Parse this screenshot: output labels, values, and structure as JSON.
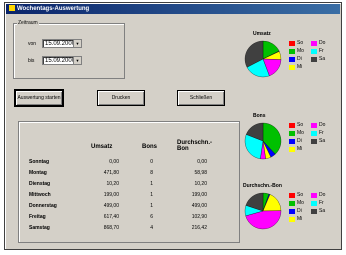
{
  "window": {
    "title": "Wochentags-Auswertung"
  },
  "zeitraum": {
    "group_label": "Zeitraum",
    "von_label": "von",
    "von_value": "15.09.2000",
    "bis_label": "bis",
    "bis_value": "15.09.2000"
  },
  "buttons": {
    "start": "Auswertung starten",
    "print": "Drucken",
    "close": "Schließen"
  },
  "table": {
    "headers": [
      "Umsatz",
      "Bons",
      "Durchschn.- Bon"
    ],
    "rows": [
      {
        "day": "Sonntag",
        "umsatz": "0,00",
        "bons": "0",
        "avg": "0,00"
      },
      {
        "day": "Montag",
        "umsatz": "471,80",
        "bons": "8",
        "avg": "58,98"
      },
      {
        "day": "Dienstag",
        "umsatz": "10,20",
        "bons": "1",
        "avg": "10,20"
      },
      {
        "day": "Mittwoch",
        "umsatz": "199,00",
        "bons": "1",
        "avg": "199,00"
      },
      {
        "day": "Donnerstag",
        "umsatz": "499,00",
        "bons": "1",
        "avg": "499,00"
      },
      {
        "day": "Freitag",
        "umsatz": "617,40",
        "bons": "6",
        "avg": "102,90"
      },
      {
        "day": "Samstag",
        "umsatz": "868,70",
        "bons": "4",
        "avg": "216,42"
      }
    ]
  },
  "legend_items": [
    {
      "label": "So",
      "color": "#ff0000"
    },
    {
      "label": "Mo",
      "color": "#00c000"
    },
    {
      "label": "Di",
      "color": "#0000ff"
    },
    {
      "label": "Mi",
      "color": "#ffff00"
    },
    {
      "label": "Do",
      "color": "#ff00ff"
    },
    {
      "label": "Fr",
      "color": "#00ffff"
    },
    {
      "label": "Sa",
      "color": "#404040"
    }
  ],
  "chart_data": [
    {
      "type": "pie",
      "title": "Umsatz",
      "categories": [
        "So",
        "Mo",
        "Di",
        "Mi",
        "Do",
        "Fr",
        "Sa"
      ],
      "values": [
        0,
        471.8,
        10.2,
        199.0,
        499.0,
        617.4,
        868.7
      ]
    },
    {
      "type": "pie",
      "title": "Bons",
      "categories": [
        "So",
        "Mo",
        "Di",
        "Mi",
        "Do",
        "Fr",
        "Sa"
      ],
      "values": [
        0,
        8,
        1,
        1,
        1,
        6,
        4
      ]
    },
    {
      "type": "pie",
      "title": "Durchschn.-Bon",
      "categories": [
        "So",
        "Mo",
        "Di",
        "Mi",
        "Do",
        "Fr",
        "Sa"
      ],
      "values": [
        0,
        58.98,
        10.2,
        199.0,
        499.0,
        102.9,
        216.42
      ]
    }
  ]
}
